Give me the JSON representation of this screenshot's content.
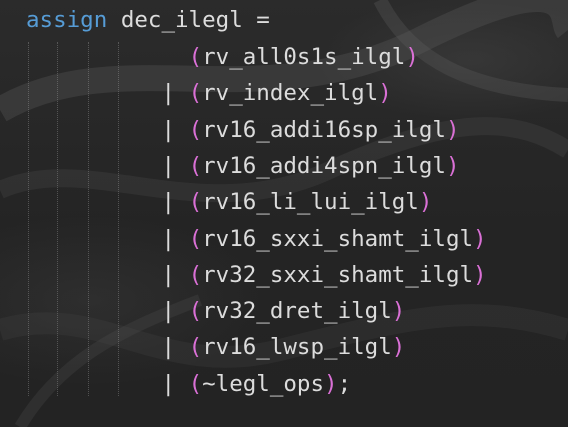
{
  "editor": {
    "colors": {
      "background": "#262626",
      "keyword": "#569cd6",
      "identifier": "#dcdcdc",
      "paren": "#da70d6"
    },
    "header": {
      "keyword": "assign",
      "name": "dec_ilegl",
      "operator": "="
    },
    "lines": [
      {
        "op": "",
        "open": "(",
        "text": "rv_all0s1s_ilgl",
        "close": ")"
      },
      {
        "op": "|",
        "open": "(",
        "text": "rv_index_ilgl",
        "close": ")"
      },
      {
        "op": "|",
        "open": "(",
        "text": "rv16_addi16sp_ilgl",
        "close": ")"
      },
      {
        "op": "|",
        "open": "(",
        "text": "rv16_addi4spn_ilgl",
        "close": ")"
      },
      {
        "op": "|",
        "open": "(",
        "text": "rv16_li_lui_ilgl",
        "close": ")"
      },
      {
        "op": "|",
        "open": "(",
        "text": "rv16_sxxi_shamt_ilgl",
        "close": ")"
      },
      {
        "op": "|",
        "open": "(",
        "text": "rv32_sxxi_shamt_ilgl",
        "close": ")"
      },
      {
        "op": "|",
        "open": "(",
        "text": "rv32_dret_ilgl",
        "close": ")"
      },
      {
        "op": "|",
        "open": "(",
        "text": "rv16_lwsp_ilgl",
        "close": ")"
      },
      {
        "op": "|",
        "open": "(",
        "text": "~legl_ops",
        "close": ");"
      }
    ]
  }
}
